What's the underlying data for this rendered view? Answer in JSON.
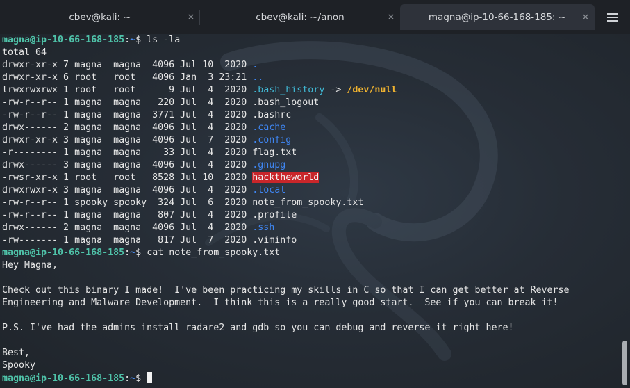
{
  "tabs": [
    {
      "title": "cbev@kali: ~",
      "active": false
    },
    {
      "title": "cbev@kali: ~/anon",
      "active": false
    },
    {
      "title": "magna@ip-10-66-168-185: ~",
      "active": true
    }
  ],
  "icons": {
    "tab_close": "✕",
    "menu": "hamburger-menu-icon"
  },
  "colors": {
    "prompt_user": "#4fc3a9",
    "prompt_path": "#4a8ff2",
    "directory": "#3f86f2",
    "symlink": "#40b8d4",
    "symlink_target": "#f0b330",
    "setuid": "#c9262a"
  },
  "prompt": {
    "user_host": "magna@ip-10-66-168-185",
    "sep": ":",
    "path": "~",
    "symbol": "$"
  },
  "terminal": {
    "cmd1": "ls -la",
    "total": "total 64",
    "listing": [
      {
        "meta": "drwxr-xr-x 7 magna  magna  4096 Jul 10  2020 ",
        "name": ".",
        "type": "dir"
      },
      {
        "meta": "drwxr-xr-x 6 root   root   4096 Jan  3 23:21 ",
        "name": "..",
        "type": "dir"
      },
      {
        "meta": "lrwxrwxrwx 1 root   root      9 Jul  4  2020 ",
        "name": ".bash_history",
        "type": "link",
        "arrow": " -> ",
        "target": "/dev/null"
      },
      {
        "meta": "-rw-r--r-- 1 magna  magna   220 Jul  4  2020 ",
        "name": ".bash_logout",
        "type": "file"
      },
      {
        "meta": "-rw-r--r-- 1 magna  magna  3771 Jul  4  2020 ",
        "name": ".bashrc",
        "type": "file"
      },
      {
        "meta": "drwx------ 2 magna  magna  4096 Jul  4  2020 ",
        "name": ".cache",
        "type": "dir"
      },
      {
        "meta": "drwxr-xr-x 3 magna  magna  4096 Jul  7  2020 ",
        "name": ".config",
        "type": "dir"
      },
      {
        "meta": "-r-------- 1 magna  magna    33 Jul  4  2020 ",
        "name": "flag.txt",
        "type": "file"
      },
      {
        "meta": "drwx------ 3 magna  magna  4096 Jul  4  2020 ",
        "name": ".gnupg",
        "type": "dir"
      },
      {
        "meta": "-rwsr-xr-x 1 root   root   8528 Jul 10  2020 ",
        "name": "hacktheworld",
        "type": "suid"
      },
      {
        "meta": "drwxrwxr-x 3 magna  magna  4096 Jul  4  2020 ",
        "name": ".local",
        "type": "dir"
      },
      {
        "meta": "-rw-r--r-- 1 spooky spooky  324 Jul  6  2020 ",
        "name": "note_from_spooky.txt",
        "type": "file"
      },
      {
        "meta": "-rw-r--r-- 1 magna  magna   807 Jul  4  2020 ",
        "name": ".profile",
        "type": "file"
      },
      {
        "meta": "drwx------ 2 magna  magna  4096 Jul  4  2020 ",
        "name": ".ssh",
        "type": "dir"
      },
      {
        "meta": "-rw------- 1 magna  magna   817 Jul  7  2020 ",
        "name": ".viminfo",
        "type": "file"
      }
    ],
    "cmd2": "cat note_from_spooky.txt",
    "note": [
      "Hey Magna,",
      "",
      "Check out this binary I made!  I've been practicing my skills in C so that I can get better at Reverse",
      "Engineering and Malware Development.  I think this is a really good start.  See if you can break it!",
      "",
      "P.S. I've had the admins install radare2 and gdb so you can debug and reverse it right here!",
      "",
      "Best,",
      "Spooky"
    ]
  }
}
